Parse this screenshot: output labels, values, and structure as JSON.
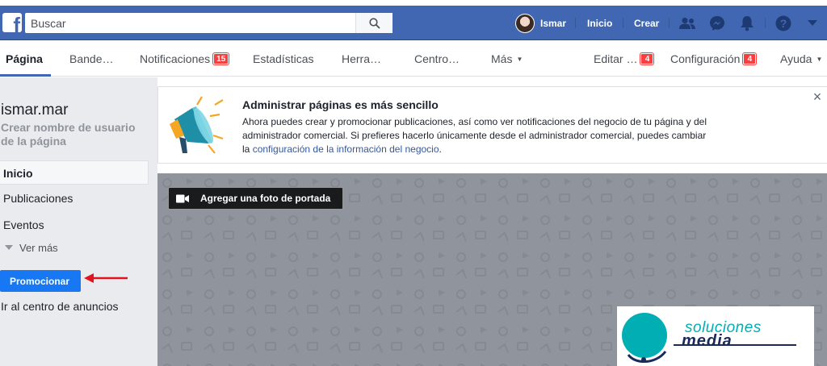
{
  "topbar": {
    "search_placeholder": "Buscar",
    "user_name": "Ismar",
    "home_label": "Inicio",
    "create_label": "Crear",
    "brand_color": "#4267b2",
    "icons": [
      "friends-icon",
      "messenger-icon",
      "notifications-bell-icon",
      "help-icon",
      "account-menu-caret-icon"
    ]
  },
  "subnav": {
    "items": [
      {
        "label": "Página"
      },
      {
        "label": "Bande…"
      },
      {
        "label": "Notificaciones",
        "badge": "15"
      },
      {
        "label": "Estadísticas"
      },
      {
        "label": "Herra…"
      },
      {
        "label": "Centro…"
      },
      {
        "label": "Más"
      },
      {
        "label": "Editar …",
        "badge": "4"
      },
      {
        "label": "Configuración",
        "badge": "4"
      },
      {
        "label": "Ayuda"
      }
    ]
  },
  "sidebar": {
    "page_name": "ismar.mar",
    "username_prompt": "Crear nombre de usuario de la página",
    "items": [
      {
        "label": "Inicio"
      },
      {
        "label": "Publicaciones"
      },
      {
        "label": "Eventos"
      }
    ],
    "see_more": "Ver más",
    "promote_button": "Promocionar",
    "ad_center": "Ir al centro de anuncios"
  },
  "notice": {
    "title": "Administrar páginas es más sencillo",
    "body_text": "Ahora puedes crear y promocionar publicaciones, así como ver notificaciones del negocio de tu página y del administrador comercial. Si prefieres hacerlo únicamente desde el administrador comercial, puedes cambiar la",
    "body_link": "configuración de la información del negocio",
    "body_end": "."
  },
  "cover": {
    "add_cover_label": "Agregar una foto de portada"
  },
  "watermark": {
    "line1": "soluciones",
    "line2": "media"
  }
}
